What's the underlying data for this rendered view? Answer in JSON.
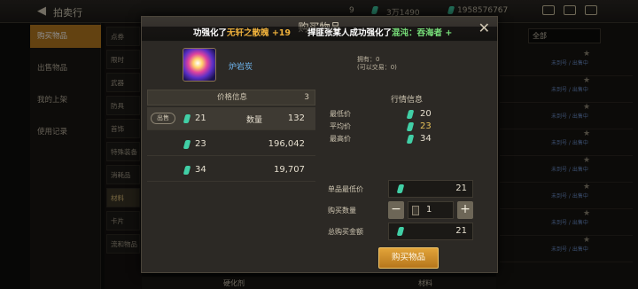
{
  "topbar": {
    "back_glyph": "◀",
    "title": "拍卖行",
    "res1": "9",
    "res2": "3万1490",
    "res3": "1958576767"
  },
  "sidebar": {
    "items": [
      {
        "label": "购买物品"
      },
      {
        "label": "出售物品"
      },
      {
        "label": "我的上架"
      },
      {
        "label": "使用记录"
      }
    ]
  },
  "categories": [
    "点券",
    "限时",
    "武器",
    "防具",
    "首饰",
    "特殊装备",
    "消耗品",
    "材料",
    "卡片",
    "流和物品"
  ],
  "right_bg": {
    "dropdown": "全部",
    "row_text": "未到号 / 出售中",
    "bottom_item1": "硬化剂",
    "bottom_item2": "材料"
  },
  "dialog": {
    "title": "购买物品",
    "close_glyph": "✕",
    "banner": {
      "m1_prefix": "功强化了",
      "m1_item": "无轩之散魄",
      "m1_suffix": "+19",
      "m2_prefix": "捍匪张某人成功强化了",
      "m2_item": "混沌：吞海者",
      "m2_suffix": "+"
    },
    "item": {
      "name": "炉岩炭",
      "own_line1": "拥有：0",
      "own_line2": "(可以交易：0)"
    },
    "listings": {
      "header": "价格信息",
      "count": "3",
      "qty_label": "数量",
      "sell_tag": "出售",
      "rows": [
        {
          "price": "21",
          "qty": "132"
        },
        {
          "price": "23",
          "qty": "196,042"
        },
        {
          "price": "34",
          "qty": "19,707"
        }
      ]
    },
    "market": {
      "header": "行情信息",
      "min_label": "最低价",
      "min": "20",
      "avg_label": "平均价",
      "avg": "23",
      "max_label": "最高价",
      "max": "34"
    },
    "purchase": {
      "unit_label": "单品最低价",
      "unit_price": "21",
      "qty_label": "购买数量",
      "qty": "1",
      "minus": "−",
      "plus": "+",
      "total_label": "总购买金额",
      "total": "21",
      "buy_label": "购买物品"
    }
  },
  "colors": {
    "accent": "#e2a43a",
    "gem": "#41cfa6",
    "highlight": "#f0b23c",
    "item_name": "#6fb6f0"
  }
}
